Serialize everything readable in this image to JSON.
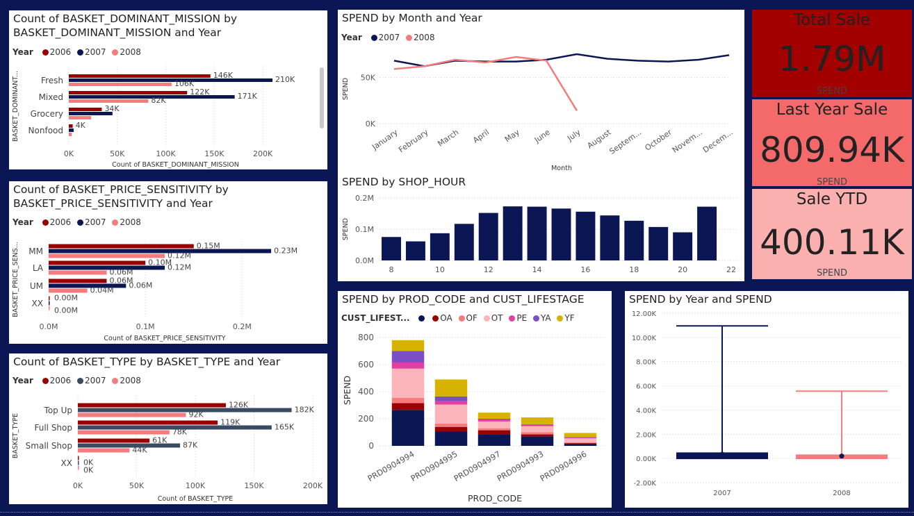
{
  "colors": {
    "y2006": "#9b0000",
    "y2007": "#0b1654",
    "y2008": "#f47c7c",
    "basket_2007": "#3b4a63",
    "kpi_total": "#a30000",
    "kpi_last": "#f46a6a",
    "kpi_ytd": "#fbb0b0",
    "life_blank": "#0b1654",
    "life_OA": "#9b0000",
    "life_OF": "#f47c7c",
    "life_OT": "#fbb4b9",
    "life_PE": "#e040a0",
    "life_YA": "#7b4fc6",
    "life_YF": "#d8b200"
  },
  "legend_year": {
    "title": "Year",
    "items": [
      "2006",
      "2007",
      "2008"
    ]
  },
  "panels": {
    "mission": {
      "title_line1": "Count of BASKET_DOMINANT_MISSION by",
      "title_line2": "BASKET_DOMINANT_MISSION and Year"
    },
    "price": {
      "title_line1": "Count of BASKET_PRICE_SENSITIVITY by",
      "title_line2": "BASKET_PRICE_SENSITIVITY and Year"
    },
    "type": {
      "title": "Count of BASKET_TYPE by BASKET_TYPE and Year"
    },
    "month": {
      "title": "SPEND by Month and Year",
      "legend_title": "Year",
      "legend_items": [
        "2007",
        "2008"
      ]
    },
    "hour": {
      "title": "SPEND by SHOP_HOUR"
    },
    "prod": {
      "title": "SPEND by PROD_CODE and CUST_LIFESTAGE",
      "legend_title": "CUST_LIFEST...",
      "legend_items": [
        "",
        "OA",
        "OF",
        "OT",
        "PE",
        "YA",
        "YF"
      ]
    },
    "box": {
      "title": "SPEND by Year and SPEND"
    }
  },
  "kpis": {
    "total": {
      "title": "Total Sale",
      "value": "1.79M",
      "sub": "SPEND"
    },
    "last": {
      "title": "Last Year Sale",
      "value": "809.94K",
      "sub": "SPEND"
    },
    "ytd": {
      "title": "Sale YTD",
      "value": "400.11K",
      "sub": "SPEND"
    }
  },
  "chart_data": [
    {
      "id": "mission",
      "type": "bar",
      "orientation": "horizontal",
      "categories": [
        "Fresh",
        "Mixed",
        "Grocery",
        "Nonfood"
      ],
      "series": [
        {
          "name": "2006",
          "values": [
            146000,
            122000,
            34000,
            4000
          ],
          "labels": [
            "146K",
            "122K",
            "34K",
            "4K"
          ]
        },
        {
          "name": "2007",
          "values": [
            210000,
            171000,
            45000,
            5000
          ],
          "labels": [
            "210K",
            "171K",
            "",
            ""
          ]
        },
        {
          "name": "2008",
          "values": [
            106000,
            82000,
            23000,
            3000
          ],
          "labels": [
            "106K",
            "82K",
            "",
            ""
          ]
        }
      ],
      "xlabel": "Count of BASKET_DOMINANT_MISSION",
      "ylabel": "BASKET_DOMINANT...",
      "xlim": [
        0,
        220000
      ],
      "xticks": [
        0,
        50000,
        100000,
        150000,
        200000
      ],
      "xtick_labels": [
        "0K",
        "50K",
        "100K",
        "150K",
        "200K"
      ]
    },
    {
      "id": "price",
      "type": "bar",
      "orientation": "horizontal",
      "categories": [
        "MM",
        "LA",
        "UM",
        "XX"
      ],
      "series": [
        {
          "name": "2006",
          "values": [
            150000,
            100000,
            60000,
            0
          ],
          "labels": [
            "0.15M",
            "0.10M",
            "0.06M",
            "0.00M"
          ]
        },
        {
          "name": "2007",
          "values": [
            230000,
            120000,
            80000,
            0
          ],
          "labels": [
            "0.23M",
            "0.12M",
            "0.06M",
            ""
          ]
        },
        {
          "name": "2008",
          "values": [
            120000,
            60000,
            40000,
            0
          ],
          "labels": [
            "0.12M",
            "0.06M",
            "0.04M",
            "0.00M"
          ]
        }
      ],
      "xlabel": "Count of BASKET_PRICE_SENSITIVITY",
      "ylabel": "BASKET_PRICE_SENS...",
      "xlim": [
        0,
        240000
      ],
      "xticks": [
        0,
        100000,
        200000
      ],
      "xtick_labels": [
        "0.0M",
        "0.1M",
        "0.2M"
      ]
    },
    {
      "id": "type",
      "type": "bar",
      "orientation": "horizontal",
      "categories": [
        "Top Up",
        "Full Shop",
        "Small Shop",
        "XX"
      ],
      "series": [
        {
          "name": "2006",
          "values": [
            126000,
            119000,
            61000,
            0
          ],
          "labels": [
            "126K",
            "119K",
            "61K",
            ""
          ]
        },
        {
          "name": "2007",
          "values": [
            182000,
            165000,
            87000,
            0
          ],
          "labels": [
            "182K",
            "165K",
            "87K",
            "0K"
          ]
        },
        {
          "name": "2008",
          "values": [
            92000,
            78000,
            44000,
            0
          ],
          "labels": [
            "92K",
            "78K",
            "44K",
            "0K"
          ]
        }
      ],
      "xlabel": "Count of BASKET_TYPE",
      "ylabel": "BASKET_TYPE",
      "xlim": [
        0,
        200000
      ],
      "xticks": [
        0,
        50000,
        100000,
        150000,
        200000
      ],
      "xtick_labels": [
        "0K",
        "50K",
        "100K",
        "150K",
        "200K"
      ]
    },
    {
      "id": "month",
      "type": "line",
      "categories": [
        "January",
        "February",
        "March",
        "April",
        "May",
        "June",
        "July",
        "August",
        "Septem...",
        "October",
        "Novem...",
        "Decem..."
      ],
      "series": [
        {
          "name": "2007",
          "values": [
            68000,
            62000,
            68000,
            67000,
            67000,
            69000,
            75000,
            70000,
            68000,
            67000,
            69000,
            74000
          ]
        },
        {
          "name": "2008",
          "values": [
            59000,
            62000,
            69000,
            66000,
            72000,
            68000,
            14000,
            null,
            null,
            null,
            null,
            null
          ]
        }
      ],
      "xlabel": "Month",
      "ylabel": "SPEND",
      "ylim": [
        0,
        90000
      ],
      "yticks": [
        0,
        50000
      ],
      "ytick_labels": [
        "0K",
        "50K"
      ]
    },
    {
      "id": "hour",
      "type": "bar",
      "categories": [
        8,
        9,
        10,
        11,
        12,
        13,
        14,
        15,
        16,
        17,
        18,
        19,
        20,
        21
      ],
      "values": [
        0.075,
        0.061,
        0.087,
        0.117,
        0.152,
        0.173,
        0.172,
        0.166,
        0.156,
        0.144,
        0.127,
        0.107,
        0.09,
        0.172
      ],
      "ylabel": "SPEND",
      "ylim": [
        0,
        0.2
      ],
      "yticks": [
        0,
        0.1,
        0.2
      ],
      "ytick_labels": [
        "0.0M",
        "0.1M",
        "0.2M"
      ],
      "xticks": [
        8,
        10,
        12,
        14,
        16,
        18,
        20,
        22
      ],
      "xtick_labels": [
        "8",
        "10",
        "12",
        "14",
        "16",
        "18",
        "20",
        "22"
      ],
      "unit": "M"
    },
    {
      "id": "prod",
      "type": "bar",
      "stacked": true,
      "categories": [
        "PRD0904994",
        "PRD0904995",
        "PRD0904997",
        "PRD0904993",
        "PRD0904996"
      ],
      "series": [
        {
          "name": "",
          "values": [
            265,
            105,
            85,
            70,
            15
          ]
        },
        {
          "name": "OA",
          "values": [
            50,
            35,
            30,
            15,
            5
          ]
        },
        {
          "name": "OF",
          "values": [
            40,
            25,
            15,
            15,
            5
          ]
        },
        {
          "name": "OT",
          "values": [
            215,
            140,
            50,
            45,
            30
          ]
        },
        {
          "name": "PE",
          "values": [
            45,
            25,
            15,
            10,
            5
          ]
        },
        {
          "name": "YA",
          "values": [
            85,
            35,
            5,
            5,
            5
          ]
        },
        {
          "name": "YF",
          "values": [
            80,
            125,
            45,
            50,
            30
          ]
        }
      ],
      "xlabel": "PROD_CODE",
      "ylabel": "SPEND",
      "ylim": [
        0,
        820
      ],
      "yticks": [
        0,
        200,
        400,
        600,
        800
      ]
    },
    {
      "id": "box",
      "type": "box",
      "categories": [
        "2007",
        "2008"
      ],
      "series": [
        {
          "name": "2007",
          "min": 0,
          "q1": 20,
          "median": 350,
          "q3": 500,
          "max": 10950
        },
        {
          "name": "2008",
          "min": 0,
          "q1": 20,
          "median": 200,
          "q3": 330,
          "max": 5560
        }
      ],
      "ylim": [
        -2000,
        12000
      ],
      "yticks": [
        -2000,
        0,
        2000,
        4000,
        6000,
        8000,
        10000,
        12000
      ],
      "ytick_labels": [
        "-2.00K",
        "0.00K",
        "2.00K",
        "4.00K",
        "6.00K",
        "8.00K",
        "10.00K",
        "12.00K"
      ]
    }
  ]
}
